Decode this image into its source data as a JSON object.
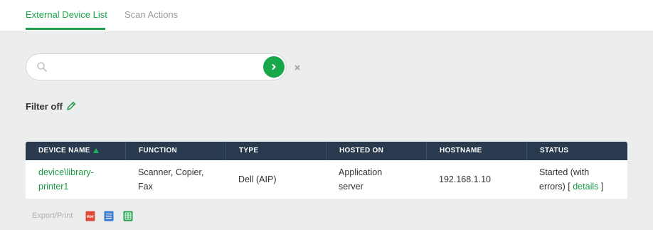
{
  "tabs": {
    "external_device_list": "External Device List",
    "scan_actions": "Scan Actions"
  },
  "search": {
    "value": "",
    "placeholder": "",
    "submit_icon": "chevron-right-icon",
    "clear_icon": "close-icon"
  },
  "filter": {
    "label": "Filter off",
    "edit_icon": "pencil-icon"
  },
  "table": {
    "headers": {
      "device_name": "DEVICE NAME",
      "function": "FUNCTION",
      "type": "TYPE",
      "hosted_on": "HOSTED ON",
      "hostname": "HOSTNAME",
      "status": "STATUS"
    },
    "sort": {
      "column": "DEVICE NAME",
      "direction": "ascending"
    },
    "rows": [
      {
        "device_name_line1": "device\\library-",
        "device_name_line2": "printer1",
        "function_line1": "Scanner, Copier,",
        "function_line2": "Fax",
        "type": "Dell (AIP)",
        "hosted_on_line1": "Application",
        "hosted_on_line2": "server",
        "hostname": "192.168.1.10",
        "status_line1": "Started (with",
        "status_line2_prefix": "errors) [",
        "status_details": "details",
        "status_line2_suffix": "]"
      }
    ]
  },
  "export": {
    "label": "Export/Print",
    "icons": [
      "pdf-icon",
      "list-icon",
      "spreadsheet-icon"
    ],
    "pdf_text": "PDF"
  },
  "colors": {
    "accent": "#1aa34a",
    "header_bg": "#293a4f",
    "page_bg": "#eceded"
  }
}
